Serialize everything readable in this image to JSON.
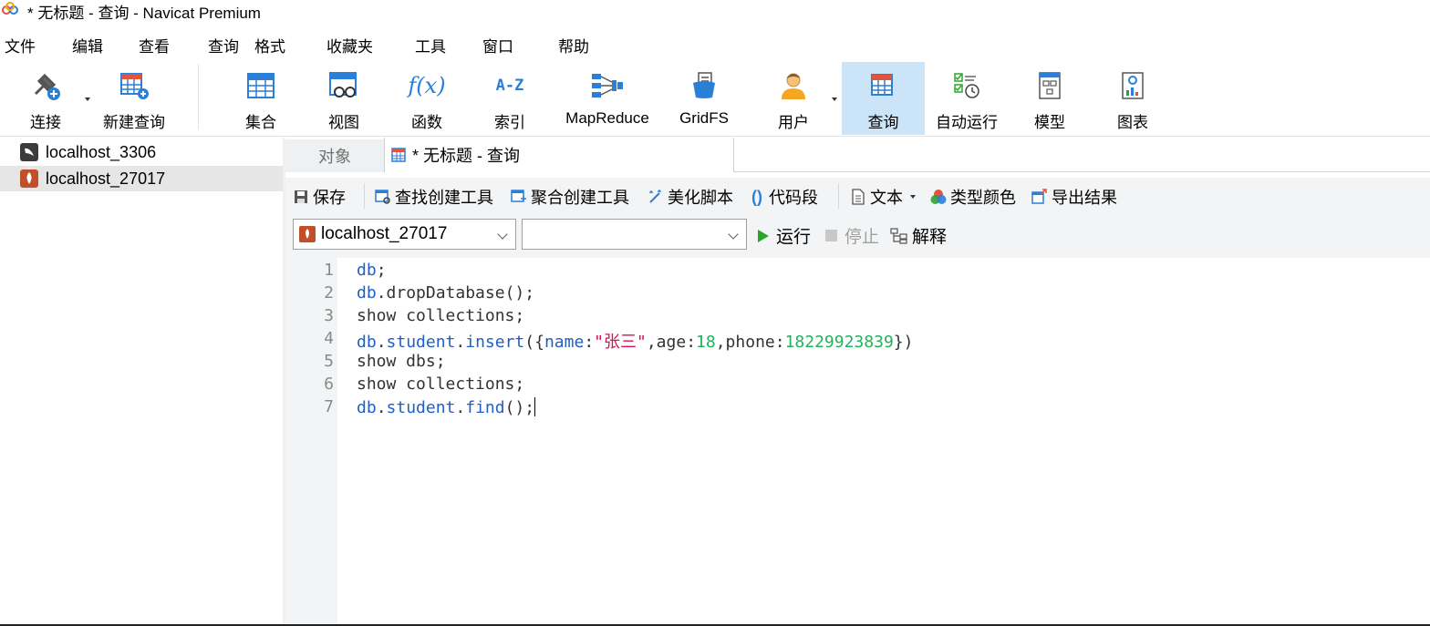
{
  "window": {
    "title": "* 无标题 - 查询 - Navicat Premium"
  },
  "menu": [
    "文件",
    "编辑",
    "查看",
    "查询",
    "格式",
    "收藏夹",
    "工具",
    "窗口",
    "帮助"
  ],
  "toolbar": {
    "connect": "连接",
    "new_query": "新建查询",
    "collection": "集合",
    "view": "视图",
    "function": "函数",
    "index": "索引",
    "mapreduce": "MapReduce",
    "gridfs": "GridFS",
    "user": "用户",
    "query": "查询",
    "automation": "自动运行",
    "model": "模型",
    "chart": "图表",
    "function_glyph": "f(x)",
    "index_glyph": "A-Z"
  },
  "connections": [
    {
      "name": "localhost_3306",
      "type": "mysql"
    },
    {
      "name": "localhost_27017",
      "type": "mongodb",
      "selected": true
    }
  ],
  "tabs": {
    "objects": "对象",
    "query": "* 无标题 - 查询"
  },
  "query_toolbar": {
    "save": "保存",
    "find_builder": "查找创建工具",
    "aggregate_builder": "聚合创建工具",
    "beautify": "美化脚本",
    "snippet": "代码段",
    "text": "文本",
    "type_color": "类型颜色",
    "export": "导出结果"
  },
  "selectors": {
    "connection": "localhost_27017",
    "database": ""
  },
  "run_controls": {
    "run": "运行",
    "stop": "停止",
    "explain": "解释"
  },
  "editor": {
    "line_numbers": [
      "1",
      "2",
      "3",
      "4",
      "5",
      "6",
      "7"
    ],
    "lines": [
      {
        "parts": [
          [
            "b",
            "db"
          ],
          [
            "t",
            ";"
          ]
        ]
      },
      {
        "parts": [
          [
            "b",
            "db"
          ],
          [
            "t",
            ".dropDatabase();"
          ]
        ]
      },
      {
        "parts": [
          [
            "t",
            "show collections;"
          ]
        ]
      },
      {
        "parts": [
          [
            "b",
            "db"
          ],
          [
            "t",
            "."
          ],
          [
            "b",
            "student"
          ],
          [
            "t",
            "."
          ],
          [
            "b",
            "insert"
          ],
          [
            "t",
            "({"
          ],
          [
            "b",
            "name"
          ],
          [
            "t",
            ":"
          ],
          [
            "r",
            "\"张三\""
          ],
          [
            "t",
            ",age:"
          ],
          [
            "g",
            "18"
          ],
          [
            "t",
            ",phone:"
          ],
          [
            "g",
            "18229923839"
          ],
          [
            "t",
            "})"
          ]
        ]
      },
      {
        "parts": [
          [
            "t",
            "show dbs;"
          ]
        ]
      },
      {
        "parts": [
          [
            "t",
            "show collections;"
          ]
        ]
      },
      {
        "parts": [
          [
            "b",
            "db"
          ],
          [
            "t",
            "."
          ],
          [
            "b",
            "student"
          ],
          [
            "t",
            "."
          ],
          [
            "b",
            "find"
          ],
          [
            "t",
            "();"
          ]
        ]
      }
    ]
  },
  "colors": {
    "keyword": "#1f5fc7",
    "string": "#d8124f",
    "number": "#1fb35a",
    "active_tool": "#cce4f7",
    "run_green": "#2aa52a"
  }
}
